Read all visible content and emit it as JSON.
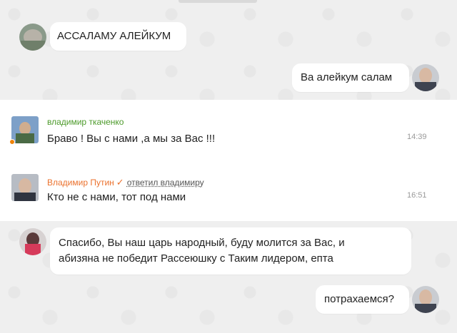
{
  "chat_top": {
    "incoming_message": "АССАЛАМУ АЛЕЙКУМ",
    "outgoing_message": "Ва алейкум салам"
  },
  "comments": [
    {
      "author": "владимир ткаченко",
      "text": "Браво ! Вы с нами ,а мы за Вас !!!",
      "time": "14:39",
      "name_color": "#4c9a2a"
    },
    {
      "author": "Владимир Путин",
      "reply_label": "ответил владимиру",
      "text": "Кто не с нами, тот под нами",
      "time": "16:51",
      "name_color": "#eb722e"
    }
  ],
  "chat_bottom": {
    "incoming_message_line1": "Спасибо, Вы наш царь народный, буду молится за Вас, и",
    "incoming_message_line2": "абизяна не победит Рассеюшку с Таким лидером, епта",
    "outgoing_message": "потрахаемся?"
  },
  "colors": {
    "chat_background": "#efefef",
    "accent_orange": "#eb722e",
    "author_green": "#4c9a2a"
  }
}
